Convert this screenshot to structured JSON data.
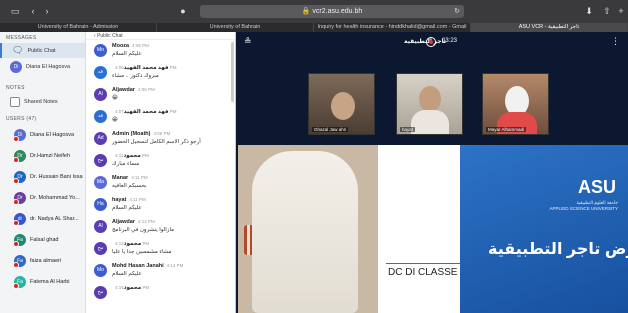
{
  "browser": {
    "address": "vcr2.asu.edu.bh",
    "tabs": [
      {
        "label": "University of Bahrain - Admission"
      },
      {
        "label": "University of Bahrain"
      },
      {
        "label": "Inquiry for health insurance - hinddkhalid@gmail.com - Gmail"
      },
      {
        "label": "ASU VCR - تاجر التطبيقية",
        "active": true
      }
    ]
  },
  "sidebar": {
    "messages_label": "MESSAGES",
    "public_chat": "Public Chat",
    "private_chat": "Diana El Hagosva",
    "notes_label": "NOTES",
    "shared_notes": "Shared Notes",
    "users_label": "USERS (47)",
    "users": [
      {
        "initials": "Di",
        "name": "Diana El Hagosva",
        "color": "#5a6bd6"
      },
      {
        "initials": "Dr",
        "name": "Dr.Hamzi Neifeh",
        "color": "#2c8b58"
      },
      {
        "initials": "Dr",
        "name": "Dr. Hussain Bani Issa",
        "color": "#1f66c7"
      },
      {
        "initials": "Dr",
        "name": "Dr. Mohammad Yo...",
        "color": "#6b3fa0"
      },
      {
        "initials": "dr",
        "name": "dr. Nadya AL Shar...",
        "color": "#3a54d1"
      },
      {
        "initials": "Fa",
        "name": "Falsal ghad",
        "color": "#1e8a72"
      },
      {
        "initials": "Fa",
        "name": "faiza almaeri",
        "color": "#3368c8"
      },
      {
        "initials": "Fa",
        "name": "Fatema Al Harbi",
        "color": "#2db3a2"
      }
    ]
  },
  "chat": {
    "header": "Public Chat",
    "messages": [
      {
        "initials": "Mo",
        "name": "Mooza",
        "time": "4:05 PM",
        "text": "عليكم السلام",
        "color": "#3e5ecf"
      },
      {
        "initials": "فه",
        "name": "فهد محمد الفهيد",
        "time": "4:06 PM",
        "text": "مبروك دكتور .. مشاء",
        "color": "#2c6fd4"
      },
      {
        "initials": "Al",
        "name": "Aljawdar",
        "time": "4:06 PM",
        "text": "😁",
        "color": "#5b3fb2"
      },
      {
        "initials": "فه",
        "name": "فهد محمد الفهيد",
        "time": "4:07 PM",
        "text": "😁",
        "color": "#2c6fd4"
      },
      {
        "initials": "Ad",
        "name": "Admin (Moath)",
        "time": "4:08 PM",
        "text": "أرجو ذكر الاسم الكامل لتسجيل الحضور",
        "color": "#5b3fb2"
      },
      {
        "initials": "مح",
        "name": "محمود",
        "time": "4:11 PM",
        "text": "مساء مبارك",
        "color": "#5a3bb0"
      },
      {
        "initials": "Ma",
        "name": "Manar",
        "time": "4:11 PM",
        "text": "بحسبكم العافيه",
        "color": "#5a6bd6"
      },
      {
        "initials": "Ha",
        "name": "hayat",
        "time": "4:11 PM",
        "text": "عليكم السلام",
        "color": "#3e5ecf"
      },
      {
        "initials": "Al",
        "name": "Aljawdar",
        "time": "4:12 PM",
        "text": "مازالوا ينشرون في البرنامج",
        "color": "#5b3fb2"
      },
      {
        "initials": "مح",
        "name": "محمود",
        "time": "4:13 PM",
        "text": "مشاء مشمسين جدا يا عليا",
        "color": "#5a3bb0"
      },
      {
        "initials": "Mo",
        "name": "Mohd Hasan Janahi",
        "time": "4:14 PM",
        "text": "عليكم السلام",
        "color": "#3e5ecf"
      },
      {
        "initials": "مح",
        "name": "محمود",
        "time": "4:15 PM",
        "text": "",
        "color": "#5a3bb0"
      }
    ]
  },
  "presentation": {
    "timer": "03:23",
    "title": "تاجر التطبيقية",
    "cams": [
      {
        "name": "Ghazal Jaw ahri"
      },
      {
        "name": "hayat"
      },
      {
        "name": "Mayar Alhammadi"
      }
    ],
    "slide": {
      "logo": "ASU",
      "university": "جامعة العلوم التطبيقية",
      "university_en": "APPLIED SCIENCE UNIVERSITY",
      "title": "معرض تاجر التطبيقية",
      "brand": "DC DI CLASSE"
    }
  },
  "colors": {
    "pres_bg": "#0b1830",
    "slide_blue": "#2d73c6",
    "accent": "#3a7bd5"
  }
}
